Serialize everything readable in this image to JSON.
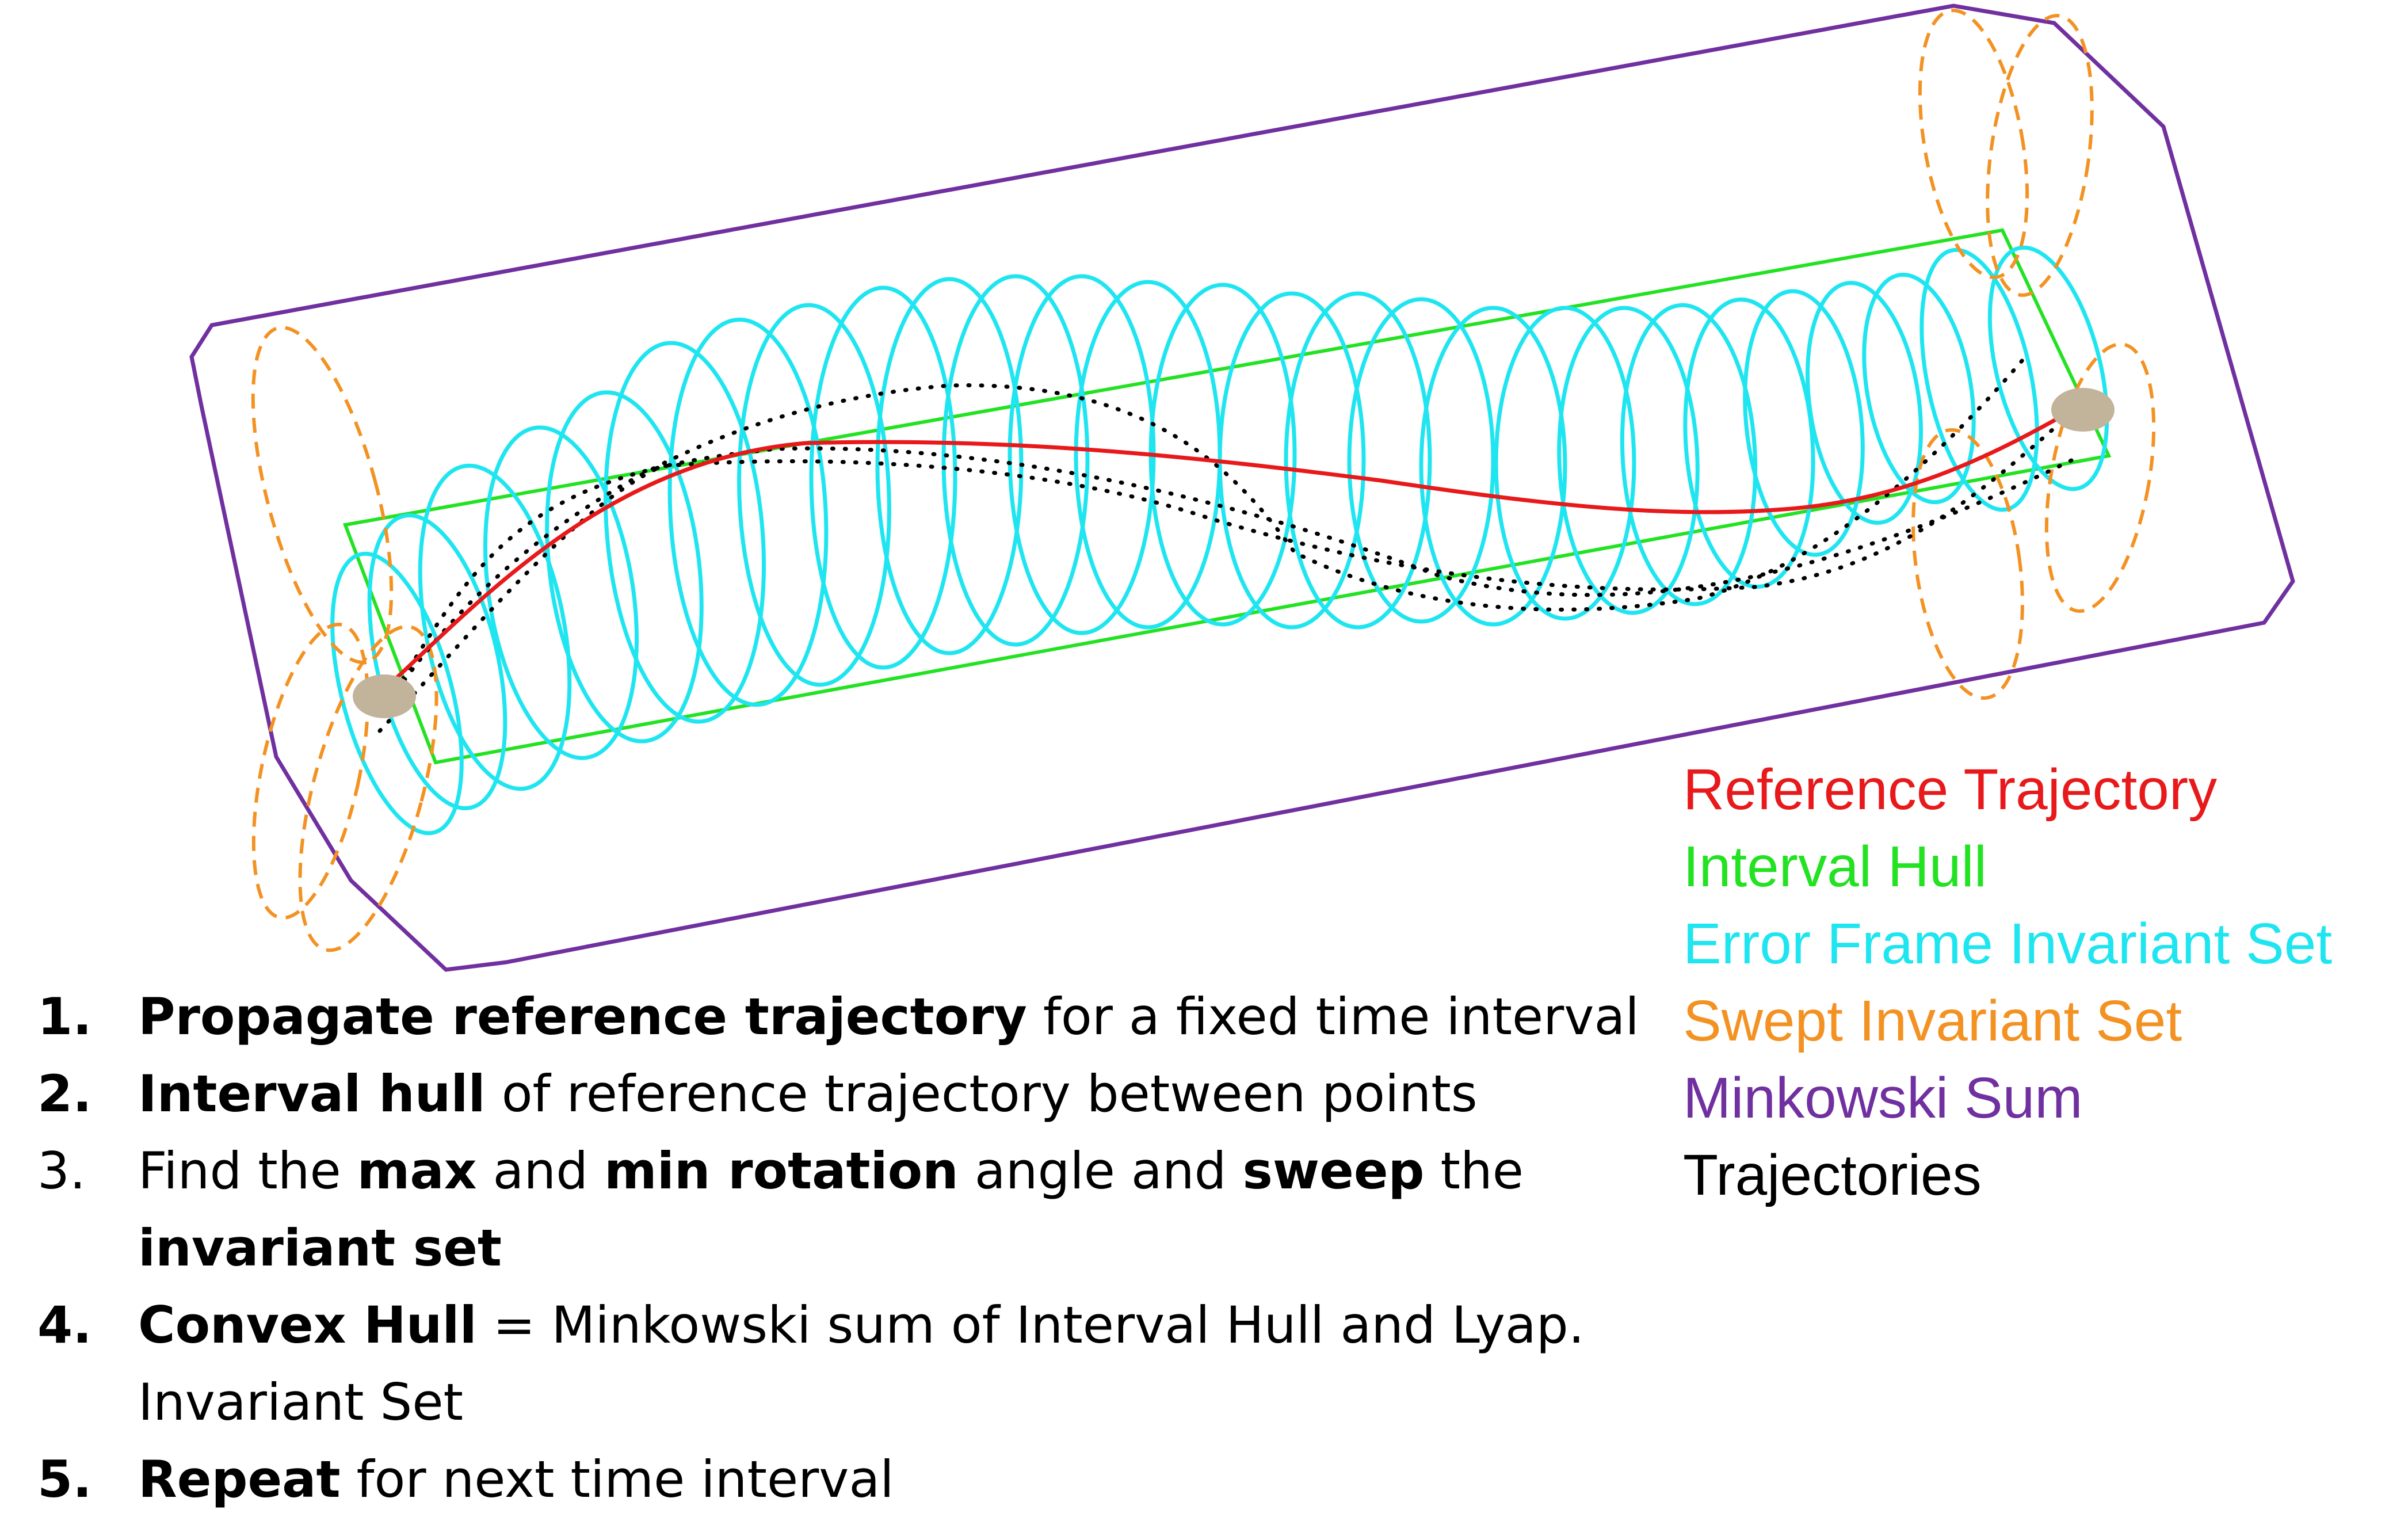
{
  "colors": {
    "reference": "#e8191b",
    "interval_hull": "#22e222",
    "error_frame": "#1fe5f0",
    "swept": "#f39222",
    "minkowski": "#7030a0",
    "trajectories": "#000000",
    "endpoint": "#c2b39b"
  },
  "legend": [
    {
      "label": "Reference Trajectory",
      "color": "#e8191b"
    },
    {
      "label": "Interval Hull",
      "color": "#22e222"
    },
    {
      "label": "Error Frame Invariant Set",
      "color": "#1fe5f0"
    },
    {
      "label": "Swept Invariant Set",
      "color": "#f39222"
    },
    {
      "label": "Minkowski Sum",
      "color": "#7030a0"
    },
    {
      "label": "Trajectories",
      "color": "#000000"
    }
  ],
  "steps": [
    {
      "number": "1.",
      "bold_number": true,
      "parts": [
        {
          "text": "Propagate reference trajectory",
          "bold": true
        },
        {
          "text": " for a fixed time interval",
          "bold": false
        }
      ]
    },
    {
      "number": "2.",
      "bold_number": true,
      "parts": [
        {
          "text": "Interval hull",
          "bold": true
        },
        {
          "text": " of reference trajectory between points",
          "bold": false
        }
      ]
    },
    {
      "number": "3.",
      "bold_number": false,
      "parts": [
        {
          "text": "Find the ",
          "bold": false
        },
        {
          "text": "max",
          "bold": true
        },
        {
          "text": " and ",
          "bold": false
        },
        {
          "text": "min rotation",
          "bold": true
        },
        {
          "text": " angle and ",
          "bold": false
        },
        {
          "text": "sweep",
          "bold": true
        },
        {
          "text": " the ",
          "bold": false
        },
        {
          "text": "invariant set",
          "bold": true
        }
      ]
    },
    {
      "number": "4.",
      "bold_number": true,
      "parts": [
        {
          "text": "Convex Hull",
          "bold": true
        },
        {
          "text": " = Minkowski sum of Interval Hull and Lyap. Invariant Set",
          "bold": false
        }
      ]
    },
    {
      "number": "5.",
      "bold_number": true,
      "parts": [
        {
          "text": "Repeat",
          "bold": true
        },
        {
          "text": " for next time interval",
          "bold": false
        }
      ]
    }
  ]
}
